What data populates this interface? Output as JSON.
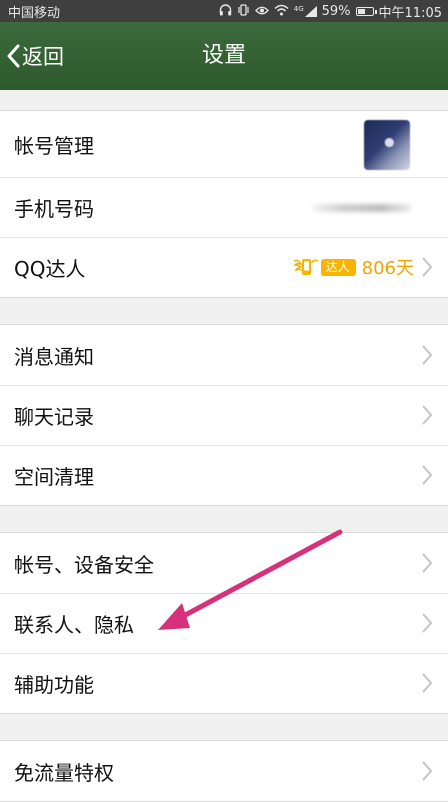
{
  "status_bar": {
    "carrier": "中国移动",
    "network": "4G",
    "battery": "59%",
    "battery_level": 0.59,
    "time": "中午11:05"
  },
  "nav": {
    "back_label": "返回",
    "title": "设置"
  },
  "groups": [
    {
      "items": [
        {
          "label": "帐号管理",
          "accessory": "avatar"
        },
        {
          "label": "手机号码",
          "accessory": "masked-phone"
        },
        {
          "label": "QQ达人",
          "badge_text": "达人",
          "value": "806天"
        }
      ]
    },
    {
      "items": [
        {
          "label": "消息通知"
        },
        {
          "label": "聊天记录"
        },
        {
          "label": "空间清理"
        }
      ]
    },
    {
      "items": [
        {
          "label": "帐号、设备安全"
        },
        {
          "label": "联系人、隐私"
        },
        {
          "label": "辅助功能"
        }
      ]
    },
    {
      "items": [
        {
          "label": "免流量特权"
        }
      ]
    }
  ],
  "annotation": {
    "type": "arrow",
    "color": "#d6317a",
    "points_to": "联系人、隐私"
  },
  "colors": {
    "nav_background": "#355f35",
    "accent_gold": "#f0a500",
    "chevron": "#c4c4c4"
  }
}
